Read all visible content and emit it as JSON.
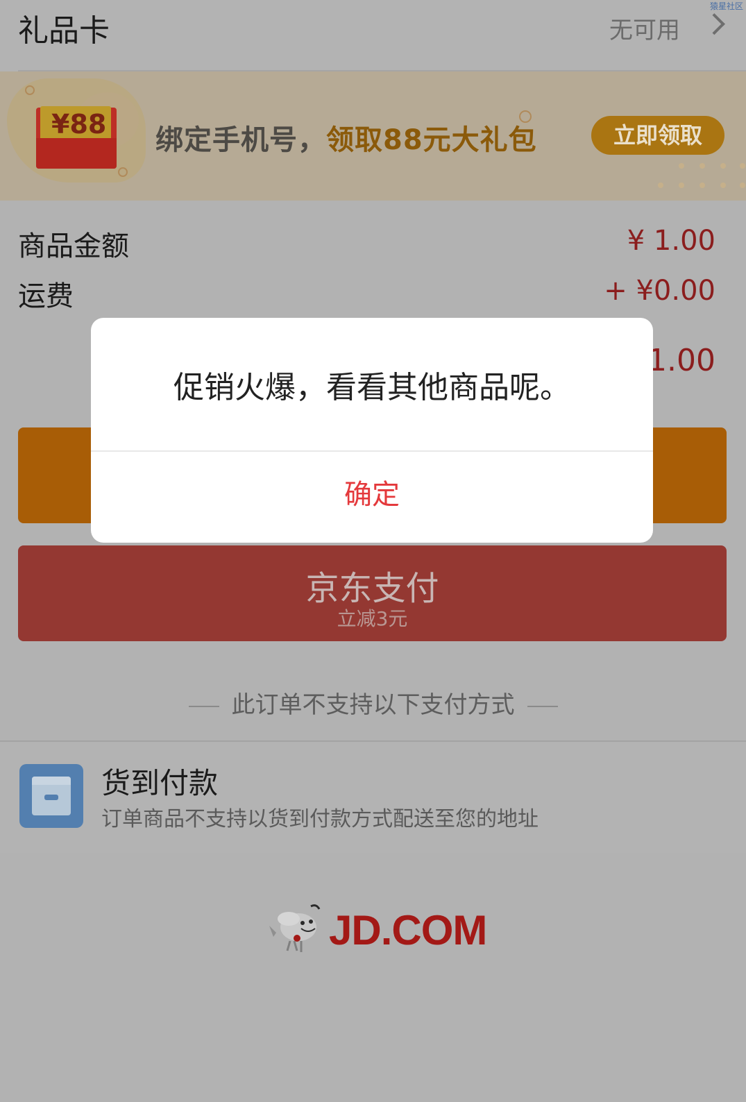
{
  "gift_card": {
    "title": "礼品卡",
    "status": "无可用"
  },
  "banner": {
    "envelope_amount": "¥88",
    "text_plain": "绑定手机号，",
    "text_highlight": "领取88元大礼包",
    "button_label": "立即领取"
  },
  "summary": {
    "items": [
      {
        "label": "商品金额",
        "value": "¥ 1.00"
      },
      {
        "label": "运费",
        "value": "+ ¥0.00"
      }
    ],
    "total_partial": "¥1.00"
  },
  "jd_pay": {
    "label": "京东支付",
    "sub_label": "立减3元"
  },
  "unsupported_heading": "此订单不支持以下支付方式",
  "cod": {
    "title": "货到付款",
    "description": "订单商品不支持以货到付款方式配送至您的地址"
  },
  "footer": {
    "logo_text": "JD.COM"
  },
  "watermark": "猿星社区",
  "modal": {
    "message": "促销火爆，看看其他商品呢。",
    "confirm_label": "确定"
  },
  "colors": {
    "accent_red": "#e4393c",
    "orange_button": "#a85d06",
    "jd_pay_button": "#943832"
  }
}
